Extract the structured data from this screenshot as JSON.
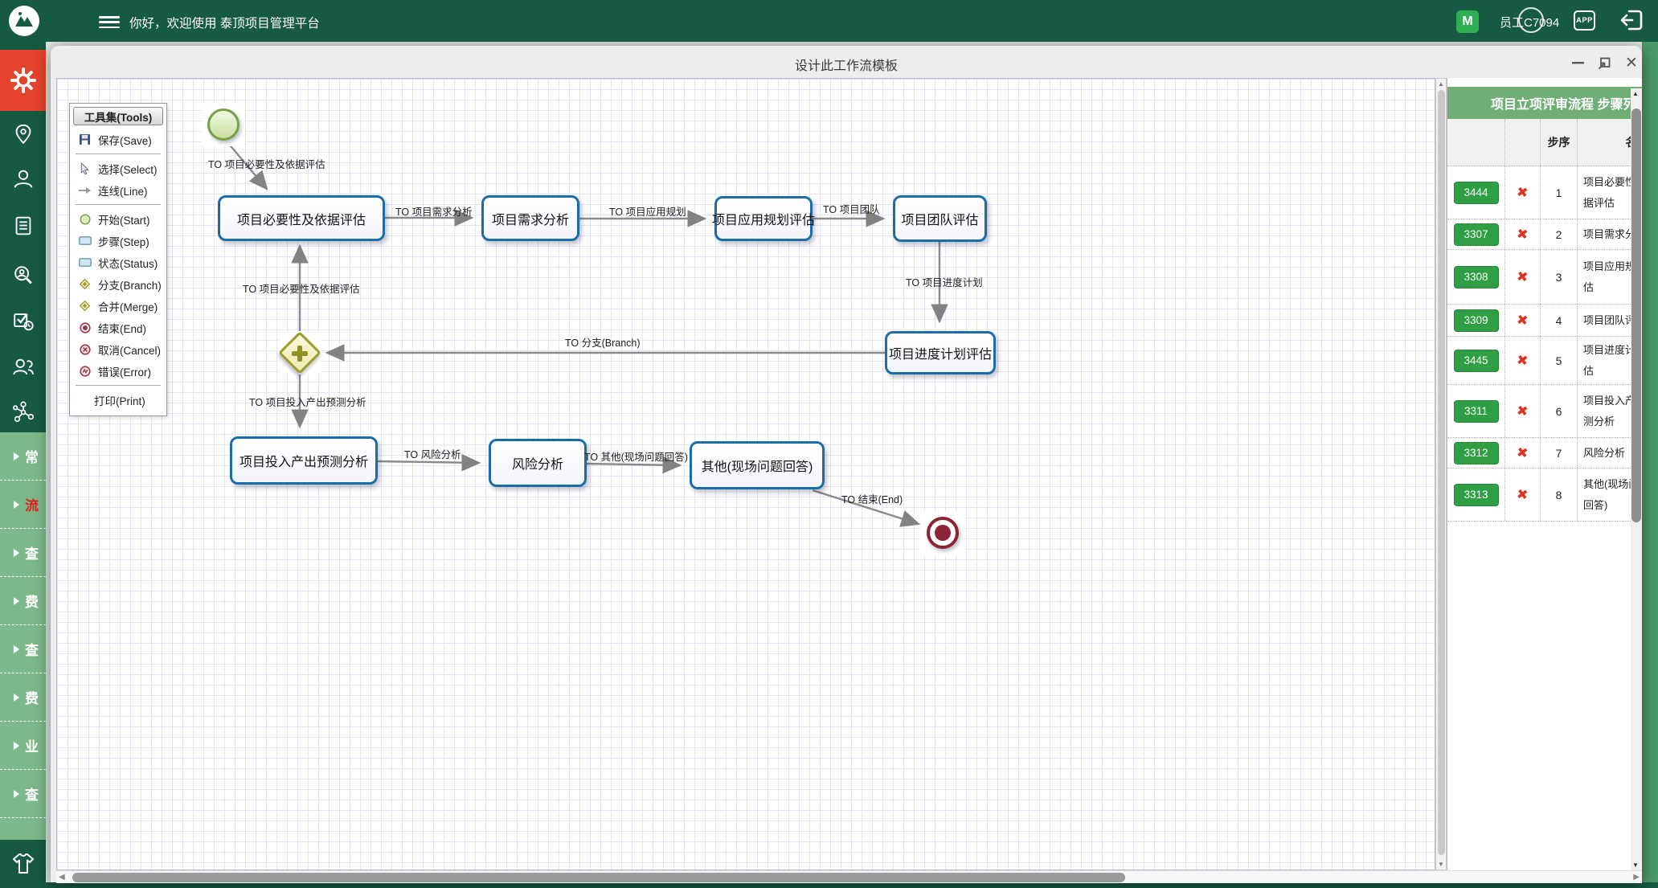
{
  "theme": {
    "topbar_green": "#175a43",
    "menu_green": "#7eb98b",
    "active_red": "#e8432d",
    "panel_header_green": "#70ae76",
    "button_green": "#2f9e44",
    "node_border_blue": "#1a6da6",
    "x_red": "#dd3322"
  },
  "topbar": {
    "title": "你好，欢迎使用 泰顶项目管理平台",
    "m_badge": "M",
    "user": "员工C7094",
    "app_label": "APP"
  },
  "sidebar": {
    "menu": [
      {
        "label": "常"
      },
      {
        "label": "流"
      },
      {
        "label": "查"
      },
      {
        "label": "费"
      },
      {
        "label": "查"
      },
      {
        "label": "费"
      },
      {
        "label": "业"
      },
      {
        "label": "查"
      }
    ]
  },
  "dialog": {
    "title": "设计此工作流模板"
  },
  "tools": {
    "header": "工具集(Tools)",
    "save": "保存(Save)",
    "select": "选择(Select)",
    "line": "连线(Line)",
    "start": "开始(Start)",
    "step": "步骤(Step)",
    "status": "状态(Status)",
    "branch": "分支(Branch)",
    "merge": "合并(Merge)",
    "end": "结束(End)",
    "cancel": "取消(Cancel)",
    "error": "错误(Error)",
    "print": "打印(Print)"
  },
  "workflow": {
    "nodes": [
      {
        "label": "项目必要性及依据评估"
      },
      {
        "label": "项目需求分析"
      },
      {
        "label": "项目应用规划评估"
      },
      {
        "label": "项目团队评估"
      },
      {
        "label": "项目进度计划评估"
      },
      {
        "label": "项目投入产出预测分析"
      },
      {
        "label": "风险分析"
      },
      {
        "label": "其他(现场问题回答)"
      }
    ],
    "labels": [
      {
        "text": "TO 项目必要性及依据评估"
      },
      {
        "text": "TO 项目需求分析"
      },
      {
        "text": "TO 项目应用规划"
      },
      {
        "text": "TO 项目团队"
      },
      {
        "text": "TO 项目进度计划"
      },
      {
        "text": "TO 分支(Branch)"
      },
      {
        "text": "TO 项目必要性及依据评估"
      },
      {
        "text": "TO 项目投入产出预测分析"
      },
      {
        "text": "TO 风险分析"
      },
      {
        "text": "TO 其他(现场问题回答)"
      },
      {
        "text": "TO 结束(End)"
      }
    ]
  },
  "panel": {
    "header": "项目立项评审流程 步骤列表",
    "columns": {
      "seq": "步序",
      "name": "名称"
    },
    "rows": [
      {
        "id": "3444",
        "seq": "1",
        "name": "项目必要性及依据评估"
      },
      {
        "id": "3307",
        "seq": "2",
        "name": "项目需求分析"
      },
      {
        "id": "3308",
        "seq": "3",
        "name": "项目应用规划评估"
      },
      {
        "id": "3309",
        "seq": "4",
        "name": "项目团队评估"
      },
      {
        "id": "3445",
        "seq": "5",
        "name": "项目进度计划评估"
      },
      {
        "id": "3311",
        "seq": "6",
        "name": "项目投入产出预测分析"
      },
      {
        "id": "3312",
        "seq": "7",
        "name": "风险分析"
      },
      {
        "id": "3313",
        "seq": "8",
        "name": "其他(现场问题回答)"
      }
    ]
  }
}
